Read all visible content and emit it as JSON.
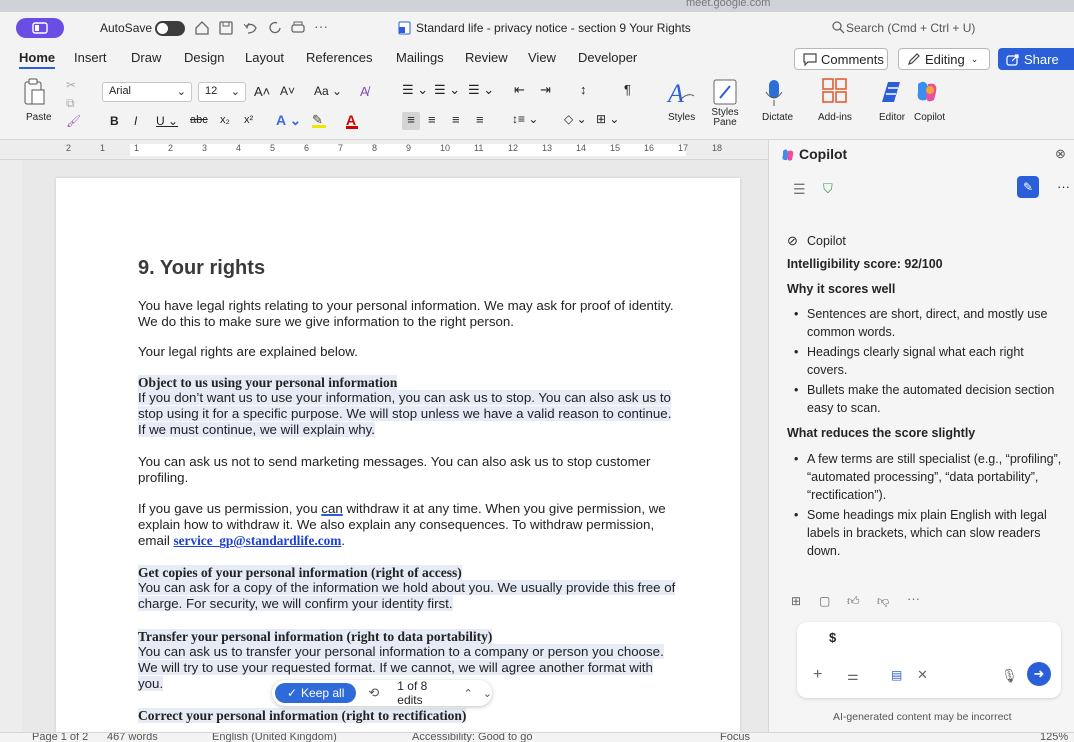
{
  "browser_strip": {
    "text": "meet.google.com"
  },
  "titlebar": {
    "autosave_label": "AutoSave",
    "doc_title": "Standard life - privacy notice - section 9 Your Rights",
    "search_placeholder": "Search (Cmd + Ctrl + U)"
  },
  "tabs": [
    "Home",
    "Insert",
    "Draw",
    "Design",
    "Layout",
    "References",
    "Mailings",
    "Review",
    "View",
    "Developer"
  ],
  "right_buttons": {
    "comments": "Comments",
    "editing": "Editing",
    "share": "Share"
  },
  "ribbon": {
    "paste": "Paste",
    "font": "Arial",
    "size": "12",
    "styles": "Styles",
    "styles_pane": "Styles Pane",
    "dictate": "Dictate",
    "addins": "Add-ins",
    "editor": "Editor",
    "copilot": "Copilot"
  },
  "ruler": [
    "2",
    "1",
    "1",
    "2",
    "3",
    "4",
    "5",
    "6",
    "7",
    "8",
    "9",
    "10",
    "11",
    "12",
    "13",
    "14",
    "15",
    "16",
    "17",
    "18"
  ],
  "doc": {
    "heading": "9. Your rights",
    "p1": "You have legal rights relating to your personal information. We may ask for proof of identity. We do this to make sure we give information to the right person.",
    "p2": "Your legal rights are explained below.",
    "s1": "Object to us using your personal information",
    "p3": "If you don’t want us to use your information, you can ask us to stop. You can also ask us to stop using it for a specific purpose. We will stop unless we have a valid reason to continue. If we must continue, we will explain why.",
    "p4": "You can ask us not to send marketing messages. You can also ask us to stop customer profiling.",
    "p5a": "If you gave us permission, you ",
    "p5b": "can",
    "p5c": " withdraw it at any time. When you give permission, we explain how to withdraw it. We also explain any consequences. To withdraw permission, email ",
    "p5link": "service_gp@standardlife.com",
    "p5d": ".",
    "s2": "Get copies of your personal information (right of access)",
    "p6": "You can ask for a copy of the information we hold about you. We usually provide this free of charge. For security, we will confirm your identity first.",
    "s3": "Transfer your personal information (right to data portability)",
    "p7": "You can ask us to transfer your personal information to a company or person you choose. We will try to use your requested format. If we cannot, we will agree another format with you.",
    "s4": "Correct your personal information (right to rectification)"
  },
  "keep": {
    "label": "Keep all",
    "edits": "1 of 8 edits"
  },
  "status": {
    "page": "Page 1 of 2",
    "words": "467 words",
    "lang": "English (United Kingdom)",
    "access": "Accessibility: Good to go",
    "focus": "Focus",
    "zoom": "125%"
  },
  "copilot": {
    "pane_title": "Copilot",
    "name": "Copilot",
    "score": "Intelligibility score: 92/100",
    "h1": "Why it scores well",
    "b1": [
      "Sentences are short, direct, and mostly use common words.",
      "Headings clearly signal what each right covers.",
      "Bullets make the automated decision section easy to scan."
    ],
    "h2": "What reduces the score slightly",
    "b2": [
      "A few terms are still specialist (e.g., “profiling”, “automated processing”, “data portability”, “rectification”).",
      "Some headings mix plain English with legal labels in brackets, which can slow readers down."
    ],
    "input_value": "$",
    "disclaimer": "AI-generated content may be incorrect"
  }
}
